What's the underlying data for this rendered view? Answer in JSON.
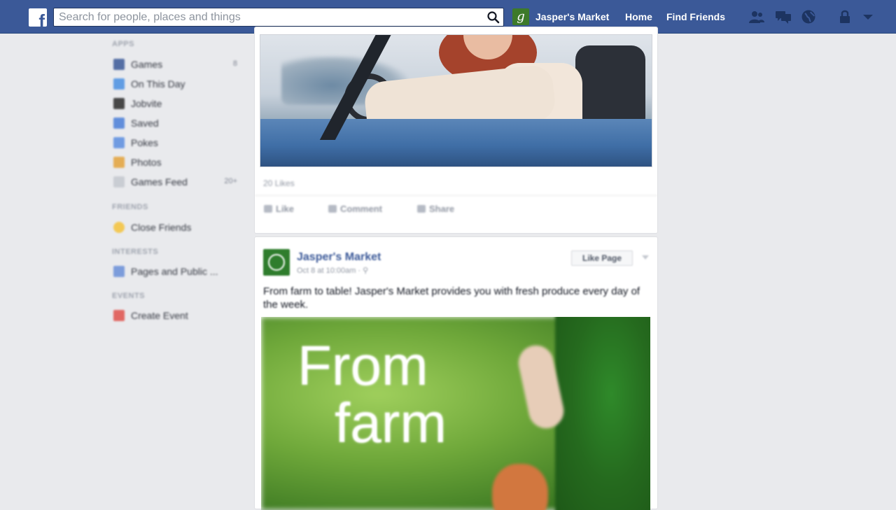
{
  "topbar": {
    "logo": "f",
    "search_placeholder": "Search for people, places and things",
    "search_value": "",
    "profile_initial": "g",
    "profile_name": "Jasper's Market",
    "home_label": "Home",
    "find_friends_label": "Find Friends",
    "jewels": [
      "friend-requests-icon",
      "messages-icon",
      "notifications-icon",
      "privacy-lock-icon",
      "account-menu-icon"
    ],
    "brand_color": "#3b5998"
  },
  "leftnav": {
    "apps_header": "APPS",
    "apps": [
      {
        "label": "Games",
        "count": "8",
        "icon": "games-icon",
        "color": "#3b5998"
      },
      {
        "label": "On This Day",
        "count": "",
        "icon": "on-this-day-icon",
        "color": "#4a90e2"
      },
      {
        "label": "Jobvite",
        "count": "",
        "icon": "jobvite-icon",
        "color": "#2b2b2b"
      },
      {
        "label": "Saved",
        "count": "",
        "icon": "saved-icon",
        "color": "#4a7fd8"
      },
      {
        "label": "Pokes",
        "count": "",
        "icon": "pokes-icon",
        "color": "#5b8ee0"
      },
      {
        "label": "Photos",
        "count": "",
        "icon": "photos-icon",
        "color": "#e4a33b"
      },
      {
        "label": "Games Feed",
        "count": "20+",
        "icon": "games-feed-icon",
        "color": "#c4c8cf"
      }
    ],
    "friends_header": "FRIENDS",
    "friends": [
      {
        "label": "Close Friends",
        "icon": "star-icon",
        "color": "#f5c33b"
      }
    ],
    "interests_header": "INTERESTS",
    "interests": [
      {
        "label": "Pages and Public ...",
        "icon": "pages-icon",
        "color": "#6a8fd8"
      }
    ],
    "events_header": "EVENTS",
    "events": [
      {
        "label": "Create Event",
        "icon": "calendar-icon",
        "color": "#e0524b"
      }
    ]
  },
  "feed": {
    "post1": {
      "likes": "20 Likes",
      "like_label": "Like",
      "comment_label": "Comment",
      "share_label": "Share"
    },
    "post2": {
      "author": "Jasper's Market",
      "timestamp": "Oct 8 at 10:00am · ⚲",
      "like_page_label": "Like Page",
      "text": "From farm to table! Jasper's Market provides you with fresh produce every day of the week.",
      "image_line1": "From",
      "image_line2": "farm"
    }
  }
}
